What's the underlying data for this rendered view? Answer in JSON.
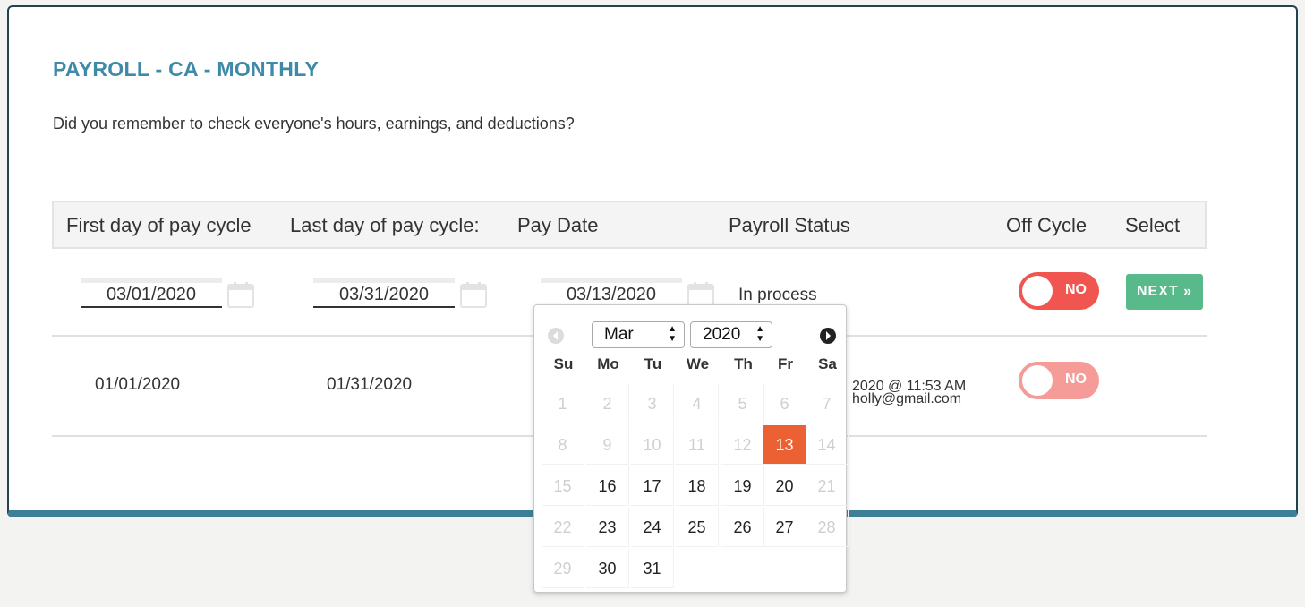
{
  "page": {
    "title": "PAYROLL - CA - MONTHLY",
    "subtitle": "Did you remember to check everyone's hours, earnings, and deductions?"
  },
  "table": {
    "headers": [
      "First day of pay cycle",
      "Last day of pay cycle:",
      "Pay Date",
      "Payroll Status",
      "Off Cycle",
      "Select"
    ],
    "rows": [
      {
        "first_day": "03/01/2020",
        "last_day": "03/31/2020",
        "pay_date": "03/13/2020",
        "status": "In process",
        "off_cycle": "NO",
        "select": "NEXT »"
      },
      {
        "first_day": "01/01/2020",
        "last_day": "01/31/2020",
        "status_line1": "2020 @ 11:53 AM",
        "status_line2": "holly@gmail.com",
        "off_cycle": "NO"
      }
    ]
  },
  "calendar": {
    "month": "Mar",
    "year": "2020",
    "weekdays": [
      "Su",
      "Mo",
      "Tu",
      "We",
      "Th",
      "Fr",
      "Sa"
    ],
    "weeks": [
      [
        "1",
        "2",
        "3",
        "4",
        "5",
        "6",
        "7"
      ],
      [
        "8",
        "9",
        "10",
        "11",
        "12",
        "13",
        "14"
      ],
      [
        "15",
        "16",
        "17",
        "18",
        "19",
        "20",
        "21"
      ],
      [
        "22",
        "23",
        "24",
        "25",
        "26",
        "27",
        "28"
      ],
      [
        "29",
        "30",
        "31",
        "",
        "",
        "",
        ""
      ]
    ],
    "selected": "13"
  },
  "colors": {
    "title": "#3f8aa8",
    "toggle_on": "#f0554f",
    "next_button": "#58b98a",
    "selected_day": "#ec6133"
  }
}
